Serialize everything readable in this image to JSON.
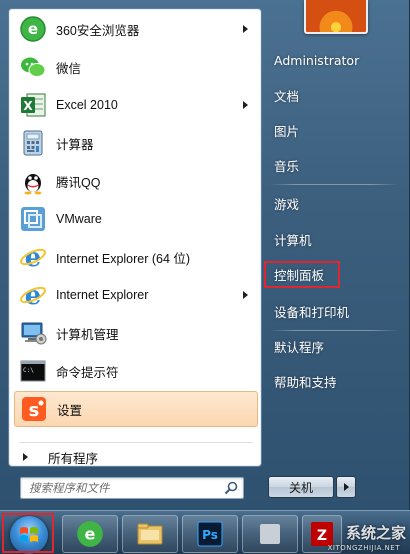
{
  "left_pane": {
    "programs": [
      {
        "label": "360安全浏览器",
        "icon": "360-browser-icon",
        "has_arrow": true
      },
      {
        "label": "微信",
        "icon": "wechat-icon",
        "has_arrow": false
      },
      {
        "label": "Excel 2010",
        "icon": "excel-icon",
        "has_arrow": true
      },
      {
        "label": "计算器",
        "icon": "calculator-icon",
        "has_arrow": false
      },
      {
        "label": "腾讯QQ",
        "icon": "qq-icon",
        "has_arrow": false
      },
      {
        "label": "VMware",
        "icon": "vmware-icon",
        "has_arrow": false
      },
      {
        "label": "Internet Explorer (64 位)",
        "icon": "ie-icon",
        "has_arrow": false
      },
      {
        "label": "Internet Explorer",
        "icon": "ie-icon",
        "has_arrow": true
      },
      {
        "label": "计算机管理",
        "icon": "computer-management-icon",
        "has_arrow": false
      },
      {
        "label": "命令提示符",
        "icon": "cmd-icon",
        "has_arrow": false
      },
      {
        "label": "设置",
        "icon": "settings-app-icon",
        "has_arrow": false,
        "highlighted": true
      }
    ],
    "all_programs": "所有程序"
  },
  "search": {
    "placeholder": "搜索程序和文件"
  },
  "right_pane": {
    "items": [
      {
        "label": "Administrator"
      },
      {
        "label": "文档"
      },
      {
        "label": "图片"
      },
      {
        "label": "音乐"
      },
      {
        "label": "游戏"
      },
      {
        "label": "计算机"
      },
      {
        "label": "控制面板",
        "highlighted": true
      },
      {
        "label": "设备和打印机"
      },
      {
        "label": "默认程序"
      },
      {
        "label": "帮助和支持"
      }
    ],
    "shutdown_label": "关机"
  },
  "taskbar": {
    "pinned": [
      "start-button",
      "360-browser",
      "file-explorer",
      "photoshop",
      "filezilla"
    ]
  },
  "watermark": {
    "title": "系统之家",
    "subtitle": "XITONGZHIJIA.NET"
  },
  "colors": {
    "highlight_red": "#e0262f",
    "hover_item": "#fbd7b1",
    "glass": "#3c5f7e"
  }
}
